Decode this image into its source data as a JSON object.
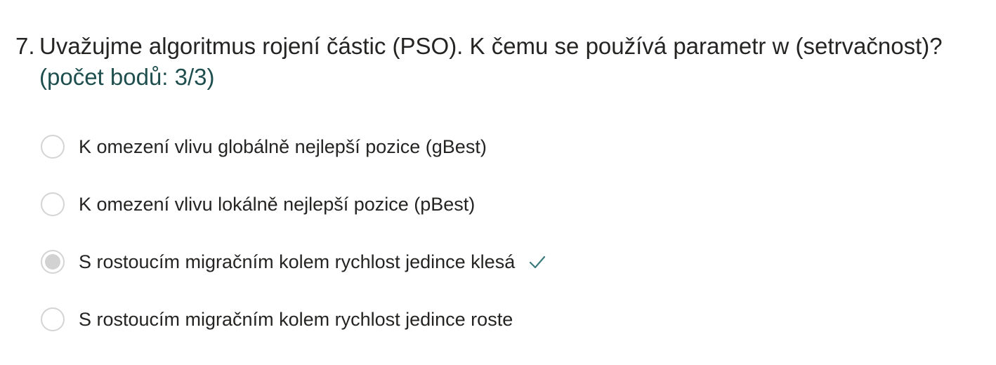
{
  "question": {
    "number": "7.",
    "title": "Uvažujme algoritmus rojení částic (PSO). K čemu se používá parametr w (setrvačnost)?",
    "points": "(počet bodů: 3/3)"
  },
  "choices": [
    {
      "label": "K omezení vlivu globálně nejlepší pozice (gBest)",
      "selected": false,
      "correct": false
    },
    {
      "label": "K omezení vlivu lokálně nejlepší pozice (pBest)",
      "selected": false,
      "correct": false
    },
    {
      "label": "S rostoucím migračním kolem rychlost jedince klesá",
      "selected": true,
      "correct": true
    },
    {
      "label": "S rostoucím migračním kolem rychlost jedince roste",
      "selected": false,
      "correct": false
    }
  ],
  "colors": {
    "points_text": "#1e4e4e",
    "check_mark": "#3b7a7a",
    "radio_border": "#d4d4d4",
    "radio_fill_selected": "#d2d2d2"
  },
  "icons": {
    "correct_marker": "checkmark-icon"
  }
}
